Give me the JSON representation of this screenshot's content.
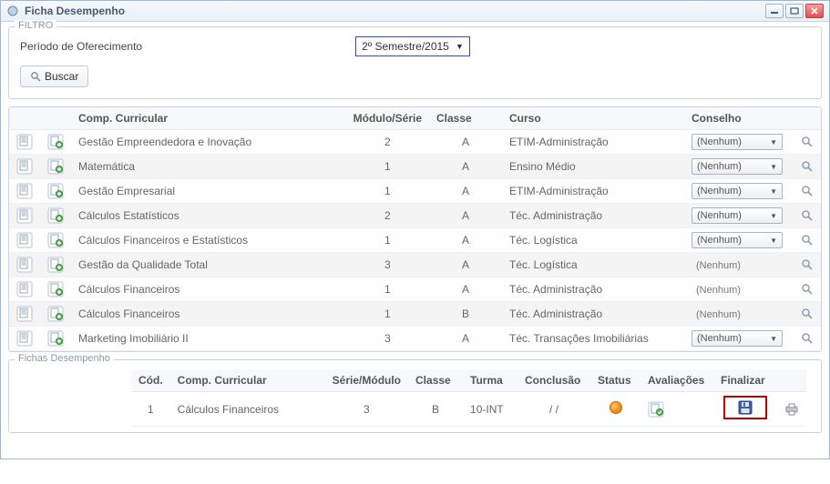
{
  "window": {
    "title": "Ficha Desempenho"
  },
  "filter": {
    "legend": "FILTRO",
    "period_label": "Período de Oferecimento",
    "period_value": "2º Semestre/2015",
    "search_label": "Buscar"
  },
  "table": {
    "headers": {
      "comp": "Comp. Curricular",
      "mod": "Módulo/Série",
      "classe": "Classe",
      "curso": "Curso",
      "conselho": "Conselho"
    },
    "rows": [
      {
        "comp": "Gestão Empreendedora e Inovação",
        "mod": "2",
        "classe": "A",
        "curso": "ETIM-Administração",
        "conselho": "(Nenhum)",
        "dropdown": true
      },
      {
        "comp": "Matemática",
        "mod": "1",
        "classe": "A",
        "curso": "Ensino Médio",
        "conselho": "(Nenhum)",
        "dropdown": true
      },
      {
        "comp": "Gestão Empresarial",
        "mod": "1",
        "classe": "A",
        "curso": "ETIM-Administração",
        "conselho": "(Nenhum)",
        "dropdown": true
      },
      {
        "comp": "Cálculos Estatísticos",
        "mod": "2",
        "classe": "A",
        "curso": "Téc. Administração",
        "conselho": "(Nenhum)",
        "dropdown": true
      },
      {
        "comp": "Cálculos Financeiros e Estatísticos",
        "mod": "1",
        "classe": "A",
        "curso": "Téc. Logística",
        "conselho": "(Nenhum)",
        "dropdown": true
      },
      {
        "comp": "Gestão da Qualidade Total",
        "mod": "3",
        "classe": "A",
        "curso": "Téc. Logística",
        "conselho": "(Nenhum)",
        "dropdown": false
      },
      {
        "comp": "Cálculos Financeiros",
        "mod": "1",
        "classe": "A",
        "curso": "Téc. Administração",
        "conselho": "(Nenhum)",
        "dropdown": false
      },
      {
        "comp": "Cálculos Financeiros",
        "mod": "1",
        "classe": "B",
        "curso": "Téc. Administração",
        "conselho": "(Nenhum)",
        "dropdown": false
      },
      {
        "comp": "Marketing Imobiliário II",
        "mod": "3",
        "classe": "A",
        "curso": "Téc. Transações Imobiliárias",
        "conselho": "(Nenhum)",
        "dropdown": true
      }
    ]
  },
  "detail": {
    "legend": "Fichas Desempenho",
    "headers": {
      "cod": "Cód.",
      "comp": "Comp. Curricular",
      "serie": "Série/Módulo",
      "classe": "Classe",
      "turma": "Turma",
      "conclusao": "Conclusão",
      "status": "Status",
      "avaliacoes": "Avaliações",
      "finalizar": "Finalizar"
    },
    "row": {
      "cod": "1",
      "comp": "Cálculos Financeiros",
      "serie": "3",
      "classe": "B",
      "turma": "10-INT",
      "conclusao": "/ /"
    }
  }
}
